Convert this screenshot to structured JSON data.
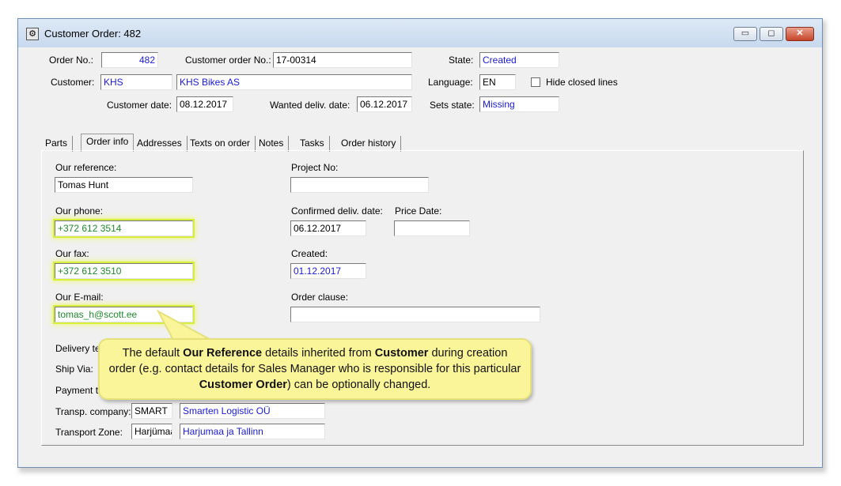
{
  "window": {
    "title": "Customer Order: 482",
    "minimize": "▭",
    "restore": "◻",
    "close": "✕",
    "icon": "gear-icon"
  },
  "header": {
    "order_no_label": "Order No.:",
    "order_no": "482",
    "customer_order_no_label": "Customer order No.:",
    "customer_order_no": "17-00314",
    "state_label": "State:",
    "state": "Created",
    "customer_label": "Customer:",
    "customer_code": "KHS",
    "customer_name": "KHS Bikes AS",
    "language_label": "Language:",
    "language": "EN",
    "hide_closed_label": "Hide closed lines",
    "customer_date_label": "Customer date:",
    "customer_date": "08.12.2017",
    "wanted_deliv_label": "Wanted deliv. date:",
    "wanted_deliv": "06.12.2017",
    "sets_state_label": "Sets state:",
    "sets_state": "Missing"
  },
  "tabs": [
    "Parts",
    "Order info",
    "Addresses",
    "Texts on order",
    "Notes",
    "Tasks",
    "Order history"
  ],
  "order_info": {
    "our_reference_label": "Our reference:",
    "our_reference": "Tomas Hunt",
    "project_no_label": "Project No:",
    "project_no": "",
    "our_phone_label": "Our phone:",
    "our_phone": "+372 612 3514",
    "confirmed_deliv_label": "Confirmed deliv. date:",
    "confirmed_deliv": "06.12.2017",
    "price_date_label": "Price Date:",
    "price_date": "",
    "our_fax_label": "Our fax:",
    "our_fax": "+372 612 3510",
    "created_label": "Created:",
    "created": "01.12.2017",
    "our_email_label": "Our E-mail:",
    "our_email": "tomas_h@scott.ee",
    "order_clause_label": "Order clause:",
    "order_clause": "",
    "delivery_terms_label": "Delivery te",
    "ship_via_label": "Ship Via:",
    "payment_terms_label": "Payment te",
    "transp_company_label": "Transp. company:",
    "transp_company_code": "SMART",
    "transp_company_name": "Smarten Logistic OÜ",
    "transport_zone_label": "Transport Zone:",
    "transport_zone_code": "Harjümaa",
    "transport_zone_name": "Harjumaa ja Tallinn"
  },
  "callout": {
    "t1": "The default ",
    "b1": "Our Reference",
    "t2": " details inherited from ",
    "b2": "Customer",
    "t3": " during creation order (e.g. contact details for Sales Manager who is responsible for this particular ",
    "b3": "Customer Order",
    "t4": ") can be optionally changed."
  }
}
